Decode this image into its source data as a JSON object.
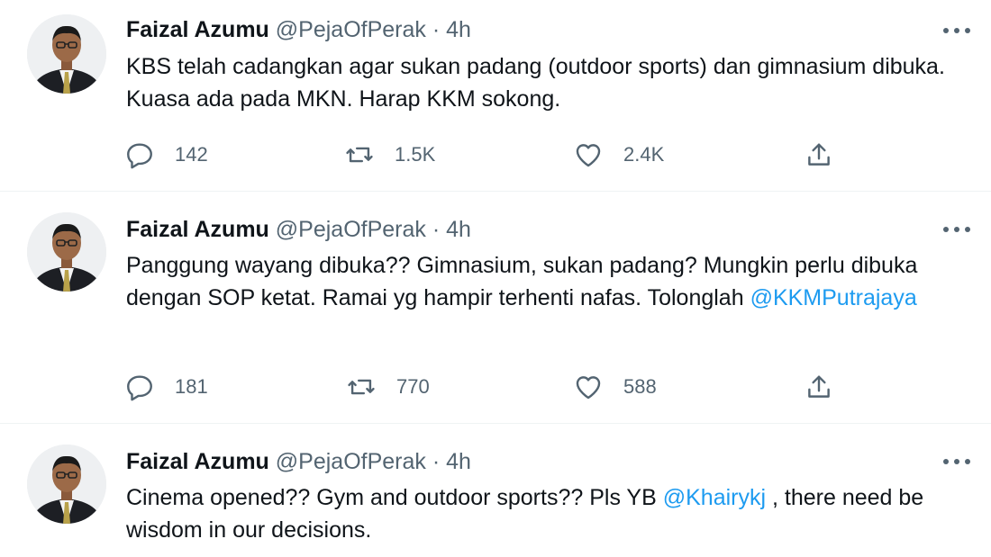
{
  "tweets": [
    {
      "name": "Faizal Azumu",
      "handle": "@PejaOfPerak",
      "dot": "·",
      "time": "4h",
      "text": "KBS telah cadangkan agar sukan padang (outdoor sports) dan gimnasium dibuka. Kuasa ada pada MKN. Harap KKM sokong.",
      "replies": "142",
      "retweets": "1.5K",
      "likes": "2.4K"
    },
    {
      "name": "Faizal Azumu",
      "handle": "@PejaOfPerak",
      "dot": "·",
      "time": "4h",
      "text_before": "Panggung wayang dibuka?? Gimnasium, sukan padang? Mungkin perlu dibuka dengan SOP ketat. Ramai yg hampir terhenti nafas. Tolonglah",
      "mention": "@KKMPutrajaya",
      "replies": "181",
      "retweets": "770",
      "likes": "588"
    },
    {
      "name": "Faizal Azumu",
      "handle": "@PejaOfPerak",
      "dot": "·",
      "time": "4h",
      "text_before": "Cinema opened?? Gym and outdoor sports?? Pls YB",
      "mention": "@Khairykj",
      "text_after": " ,  there need be wisdom in our decisions."
    }
  ],
  "icons": {
    "reply": "reply-icon",
    "retweet": "retweet-icon",
    "like": "like-icon",
    "share": "share-icon",
    "more": "more-icon"
  },
  "colors": {
    "mention": "#1d9bf0",
    "secondary_text": "#536471",
    "divider": "#eff3f4"
  }
}
